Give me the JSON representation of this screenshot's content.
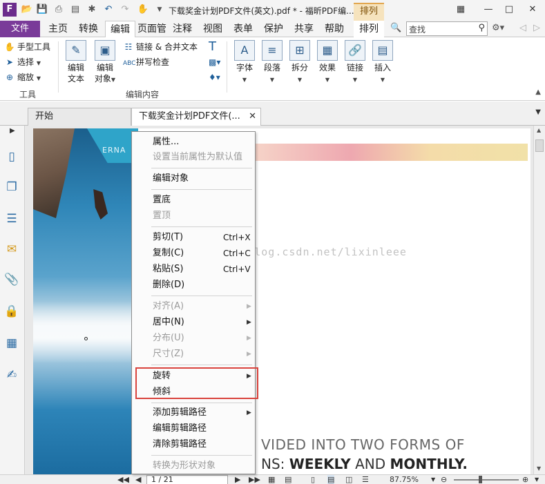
{
  "titlebar": {
    "title": "下载奖金计划PDF文件(英文).pdf * - 福昕PDF编...",
    "context_tab": "排列",
    "logo": "F",
    "quick_access": [
      "open-icon",
      "save-icon",
      "print-icon",
      "scan-icon",
      "new-icon",
      "undo-icon",
      "redo-icon",
      "hand-icon",
      "customize-icon"
    ],
    "window_buttons": [
      "ribbon-options-icon",
      "minimize-icon",
      "restore-icon",
      "close-icon"
    ]
  },
  "menubar": {
    "file": "文件",
    "items": [
      "主页",
      "转换",
      "编辑",
      "页面管",
      "注释",
      "视图",
      "表单",
      "保护",
      "共享",
      "帮助",
      "排列"
    ],
    "active": "编辑",
    "search_placeholder": "查找"
  },
  "ribbon": {
    "tools": {
      "hand": "手型工具",
      "select": "选择",
      "zoom": "缩放",
      "group_label": "工具"
    },
    "edit_text": [
      "编辑",
      "文本"
    ],
    "edit_object": [
      "编辑",
      "对象"
    ],
    "link_merge": "链接 & 合并文本",
    "spell_check": "拼写检查",
    "edit_group_label": "编辑内容",
    "buttons": [
      "字体",
      "段落",
      "拆分",
      "效果",
      "链接",
      "插入"
    ]
  },
  "tabs": [
    {
      "label": "开始"
    },
    {
      "label": "下载奖金计划PDF文件(..."
    }
  ],
  "document": {
    "logo_text": "ERNA",
    "headline1": "VIDED INTO TWO FORMS OF",
    "headline2_a": "NS: ",
    "headline2_b": "WEEKLY",
    "headline2_c": " AND ",
    "headline2_d": "MONTHLY.",
    "watermark": "http://blog.csdn.net/lixinleee"
  },
  "context_menu": {
    "items": [
      {
        "label": "属性...",
        "disabled": false
      },
      {
        "label": "设置当前属性为默认值",
        "disabled": true
      },
      {
        "label": "编辑对象",
        "disabled": false
      },
      {
        "label": "置底",
        "disabled": false
      },
      {
        "label": "置顶",
        "disabled": true
      },
      {
        "label": "剪切(T)",
        "shortcut": "Ctrl+X",
        "disabled": false
      },
      {
        "label": "复制(C)",
        "shortcut": "Ctrl+C",
        "disabled": false
      },
      {
        "label": "粘贴(S)",
        "shortcut": "Ctrl+V",
        "disabled": false
      },
      {
        "label": "删除(D)",
        "disabled": false
      },
      {
        "label": "对齐(A)",
        "disabled": true,
        "submenu": true
      },
      {
        "label": "居中(N)",
        "disabled": false,
        "submenu": true
      },
      {
        "label": "分布(U)",
        "disabled": true,
        "submenu": true
      },
      {
        "label": "尺寸(Z)",
        "disabled": true,
        "submenu": true
      },
      {
        "label": "旋转",
        "disabled": false,
        "submenu": true
      },
      {
        "label": "倾斜",
        "disabled": false
      },
      {
        "label": "添加剪辑路径",
        "disabled": false,
        "submenu": true
      },
      {
        "label": "编辑剪辑路径",
        "disabled": false
      },
      {
        "label": "清除剪辑路径",
        "disabled": false
      },
      {
        "label": "转换为形状对象",
        "disabled": true
      }
    ],
    "highlight_color": "#d9433c"
  },
  "statusbar": {
    "page": "1 / 21",
    "zoom": "87.75%"
  },
  "colors": {
    "accent": "#7a3b99",
    "context_tab_bg": "#f6e3bd"
  }
}
